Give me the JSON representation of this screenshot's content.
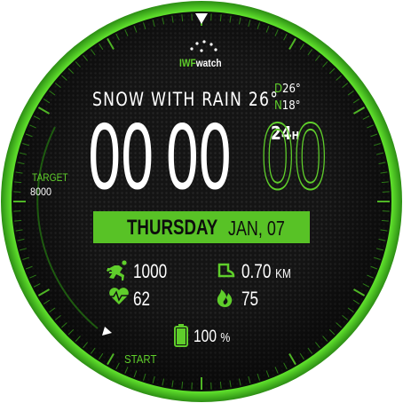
{
  "brand": {
    "part1": "IWF",
    "part2": "watch"
  },
  "weather": {
    "condition": "SNOW WITH RAIN",
    "temperature": "26°",
    "day_label": "D",
    "day_temp": "26°",
    "night_label": "N",
    "night_temp": "18°"
  },
  "time": {
    "hours": "00",
    "minutes": "00",
    "seconds": "00",
    "format": "24",
    "format_unit": "H"
  },
  "target": {
    "label": "TARGET",
    "value": "8000"
  },
  "date": {
    "weekday": "THURSDAY",
    "month_day": "JAN, 07"
  },
  "stats": {
    "steps": {
      "icon": "running-icon",
      "value": "1000"
    },
    "distance": {
      "icon": "shoe-icon",
      "value": "0.70",
      "unit": "KM"
    },
    "heart_rate": {
      "icon": "heart-pulse-icon",
      "value": "62"
    },
    "calories": {
      "icon": "flame-icon",
      "value": "75"
    }
  },
  "battery": {
    "icon": "battery-icon",
    "value": "100",
    "unit": "%",
    "level": 1.0
  },
  "step_progress": {
    "label": "START",
    "fraction": 0.0
  },
  "colors": {
    "accent": "#5fce2b",
    "dial": "#121212",
    "rim": "#3aa51c"
  }
}
